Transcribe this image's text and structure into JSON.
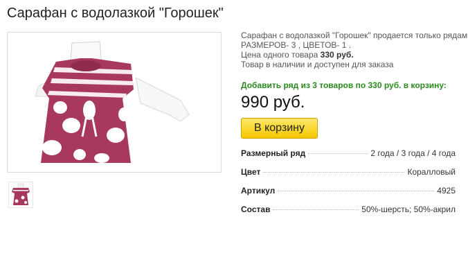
{
  "product": {
    "title": "Сарафан с водолазкой \"Горошек\""
  },
  "info": {
    "line1": "Сарафан с водолазкой \"Горошек\" продается только рядами",
    "line2": "РАЗМЕРОВ- 3 , ЦВЕТОВ- 1 .",
    "price_label": "Цена одного товара",
    "unit_price": "330 руб.",
    "availability": "Товар в наличии и доступен для заказа"
  },
  "add_row_text": "Добавить ряд из 3 товаров по 330 руб. в корзину:",
  "total_price": "990 руб.",
  "cart_button": "В корзину",
  "properties": [
    {
      "label": "Размерный ряд",
      "value": "2 года / 3 года / 4 года"
    },
    {
      "label": "Цвет",
      "value": "Коралловый"
    },
    {
      "label": "Артикул",
      "value": "4925"
    },
    {
      "label": "Состав",
      "value": "50%-шерсть; 50%-акрил"
    }
  ],
  "colors": {
    "dress": "#a8385f",
    "stripe": "#ffffff",
    "cart_button": "#f5c700",
    "add_row_text": "#2a8a1d"
  }
}
